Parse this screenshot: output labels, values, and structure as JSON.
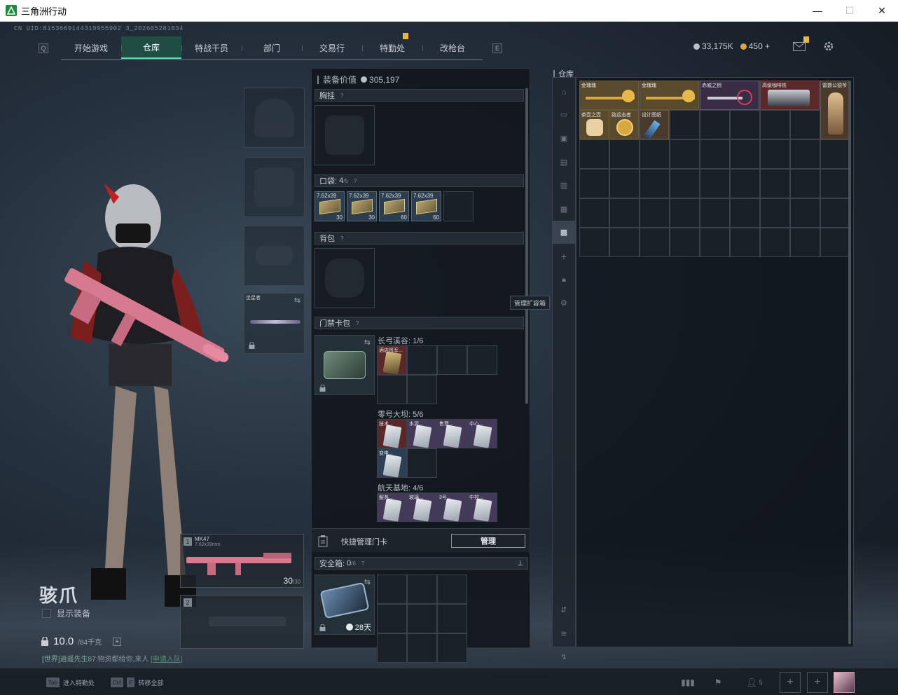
{
  "window": {
    "title": "三角洲行动",
    "minimize": "—",
    "maximize": "☐",
    "close": "✕"
  },
  "uid": "CN UID:8153669144319955902 3_202605281034",
  "nav": {
    "tabs": [
      "开始游戏",
      "仓库",
      "特战干员",
      "部门",
      "交易行",
      "特勤处",
      "改枪台"
    ],
    "active_index": 1
  },
  "currency": {
    "silver": "33,175K",
    "gold": "450",
    "gold_plus": "+"
  },
  "character": {
    "name": "骇爪",
    "show_equipment": "显示装备",
    "weight": "10.0",
    "weight_max": "/84千克"
  },
  "chat": {
    "prefix": "[世界]",
    "user": "逍遥先生87",
    "message": ":物资都给你,来人",
    "link": "[申请入队]"
  },
  "melee": {
    "label": "坐星者"
  },
  "weapons": [
    {
      "slot": "1",
      "name": "MK47",
      "ammo_type": "7.62x39mm",
      "ammo": "30",
      "ammo_max": "/30"
    },
    {
      "slot": "2",
      "name": ""
    }
  ],
  "equipment_value": {
    "label": "装备价值",
    "value": "305,197"
  },
  "sections": {
    "chest_rig": {
      "title": "胸挂",
      "hint": "?"
    },
    "pockets": {
      "title": "口袋:",
      "used": "4",
      "max": "/5",
      "hint": "?"
    },
    "backpack": {
      "title": "背包",
      "hint": "?"
    },
    "keycard": {
      "title": "门禁卡包",
      "hint": "?"
    },
    "safebox": {
      "title": "安全箱:",
      "used": "0",
      "max": "/6",
      "hint": "?",
      "expiry": "28天"
    }
  },
  "pocket_items": [
    {
      "label": "7.62x39",
      "count": "30"
    },
    {
      "label": "7.62x39",
      "count": "30"
    },
    {
      "label": "7.62x39",
      "count": "60"
    },
    {
      "label": "7.62x39",
      "count": "60"
    }
  ],
  "keycard_maps": [
    {
      "name": "长弓溪谷: 1/6",
      "cards": [
        "酒店将军..."
      ]
    },
    {
      "name": "零号大坝: 5/6",
      "cards": [
        "技术...",
        "水泥...",
        "售票...",
        "中心...",
        "变电..."
      ]
    },
    {
      "name": "航天基地: 4/6",
      "cards": [
        "服务...",
        "玻璃...",
        "3号...",
        "中控..."
      ]
    }
  ],
  "quick_manage": {
    "label": "快捷管理门卡",
    "button": "管理"
  },
  "tooltip": "管理扩容箱",
  "storage": {
    "title": "仓库",
    "items": [
      {
        "label": "金瑰瑰"
      },
      {
        "label": "金瑰瑰"
      },
      {
        "label": "赤威之钥"
      },
      {
        "label": "高级咖啡铁"
      },
      {
        "label": "雷爵公德爷"
      },
      {
        "label": "茶壶之壶"
      },
      {
        "label": "路远志者"
      },
      {
        "label": "设计图纸"
      }
    ]
  },
  "bottom": {
    "hint1_key": "Tab",
    "hint1": "进入特勤处",
    "hint2_key1": "Ctrl",
    "hint2_key2": "F",
    "hint2": "转移全部",
    "friends": "5"
  },
  "colors": {
    "accent": "#4fe0b0",
    "active_tab_bg": "#1f4d44",
    "badge": "#e7b93a",
    "gold_coin": "#d9a640",
    "silver_coin": "#b8c0c8"
  }
}
